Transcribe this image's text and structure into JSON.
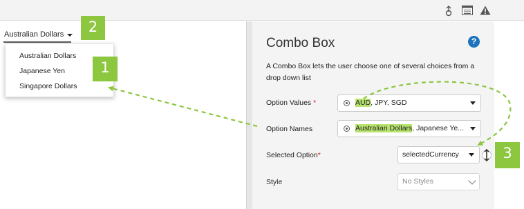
{
  "toolbar": {
    "icons": [
      "upload-icon",
      "list-icon",
      "warning-icon"
    ]
  },
  "combo_preview": {
    "selected_label": "Australian Dollars",
    "options": [
      "Australian Dollars",
      "Japanese Yen",
      "Singapore Dollars"
    ]
  },
  "badges": {
    "one": "1",
    "two": "2",
    "three": "3"
  },
  "panel": {
    "title": "Combo Box",
    "help_label": "?",
    "description": "A Combo Box lets the user choose one of several choices from a drop down list",
    "option_values": {
      "label": "Option Values",
      "required": "*",
      "value_highlight": "AUD",
      "value_rest": ", JPY, SGD"
    },
    "option_names": {
      "label": "Option Names",
      "value_highlight": "Australian Dollars",
      "value_rest": ", Japanese Ye..."
    },
    "selected_option": {
      "label": "Selected Option",
      "required": "*",
      "value": "selectedCurrency"
    },
    "style": {
      "label": "Style",
      "value": "No Styles"
    }
  },
  "colors": {
    "accent_green": "#8dc63f",
    "highlight_green": "#b7e26e",
    "help_blue": "#1e73be",
    "required_red": "#d02020"
  }
}
